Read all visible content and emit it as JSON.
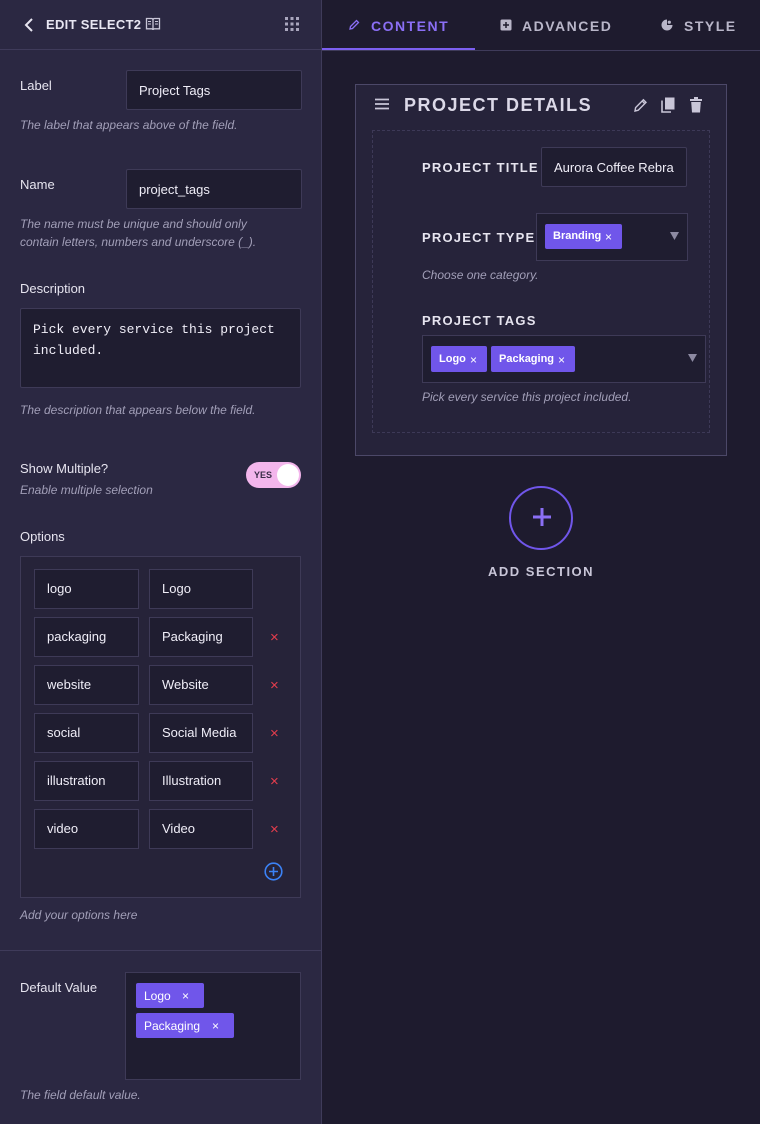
{
  "panel": {
    "title": "EDIT SELECT2"
  },
  "label_field": {
    "label": "Label",
    "value": "Project Tags",
    "help": "The label that appears above of the field."
  },
  "name_field": {
    "label": "Name",
    "value": "project_tags",
    "help_line1": "The name must be unique and should only",
    "help_line2": "contain letters, numbers and underscore (_)."
  },
  "description_field": {
    "label": "Description",
    "value": "Pick every service this project included.",
    "help": "The description that appears below the field."
  },
  "show_multiple": {
    "label": "Show Multiple?",
    "sublabel": "Enable multiple selection",
    "toggle_text": "YES",
    "enabled": true
  },
  "options": {
    "label": "Options",
    "items": [
      {
        "value": "logo",
        "label": "Logo"
      },
      {
        "value": "packaging",
        "label": "Packaging"
      },
      {
        "value": "website",
        "label": "Website"
      },
      {
        "value": "social",
        "label": "Social Media"
      },
      {
        "value": "illustration",
        "label": "Illustration"
      },
      {
        "value": "video",
        "label": "Video"
      }
    ],
    "help": "Add your options here",
    "delete_glyph": "×"
  },
  "default_value": {
    "label": "Default Value",
    "chips": [
      "Logo",
      "Packaging"
    ],
    "help": "The field default value."
  },
  "tabs": [
    {
      "label": "CONTENT",
      "icon": "pencil-icon",
      "active": true
    },
    {
      "label": "ADVANCED",
      "icon": "advanced-icon",
      "active": false
    },
    {
      "label": "STYLE",
      "icon": "palette-icon",
      "active": false
    }
  ],
  "section": {
    "title": "PROJECT DETAILS",
    "project_title": {
      "label": "PROJECT TITLE",
      "value": "Aurora Coffee Rebrand"
    },
    "project_type": {
      "label": "PROJECT TYPE",
      "chip": "Branding",
      "help": "Choose one category."
    },
    "project_tags": {
      "label": "PROJECT TAGS",
      "chips": [
        "Logo",
        "Packaging"
      ],
      "help": "Pick every service this project included."
    }
  },
  "add_section": {
    "label": "ADD SECTION"
  },
  "colors": {
    "accent": "#7056ea",
    "toggle": "#f3b6ec",
    "delete": "#e53d4d",
    "panel": "#2b2842",
    "background": "#1e1b2e"
  },
  "chip_close_glyph": "×"
}
